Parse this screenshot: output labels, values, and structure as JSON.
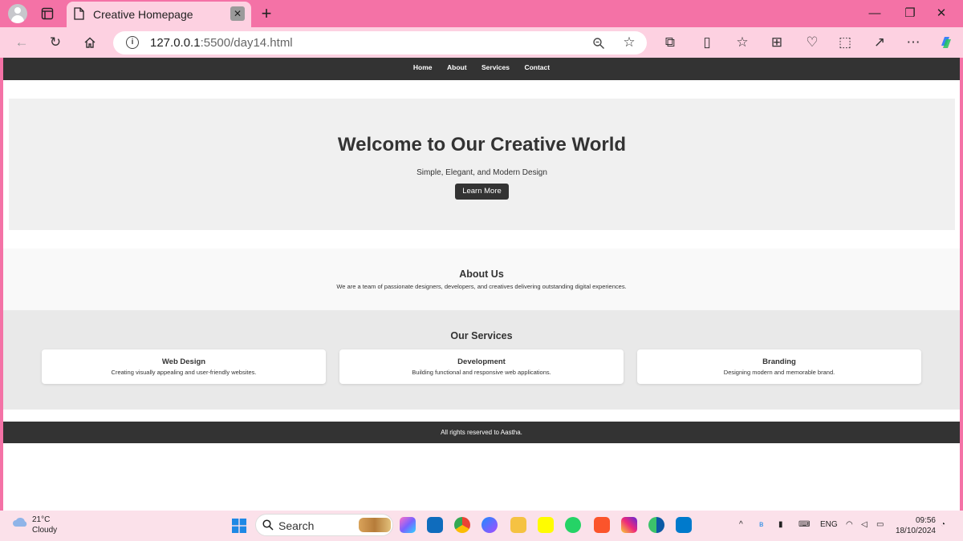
{
  "browser": {
    "tab_title": "Creative Homepage",
    "url_host": "127.0.0.1",
    "url_rest": ":5500/day14.html"
  },
  "page": {
    "nav": [
      "Home",
      "About",
      "Services",
      "Contact"
    ],
    "hero": {
      "title": "Welcome to Our Creative World",
      "subtitle": "Simple, Elegant, and Modern Design",
      "button": "Learn More"
    },
    "about": {
      "title": "About Us",
      "text": "We are a team of passionate designers, developers, and creatives delivering outstanding digital experiences."
    },
    "services": {
      "title": "Our Services",
      "cards": [
        {
          "title": "Web Design",
          "text": "Creating visually appealing and user-friendly websites."
        },
        {
          "title": "Development",
          "text": "Building functional and responsive web applications."
        },
        {
          "title": "Branding",
          "text": "Designing modern and memorable brand."
        }
      ]
    },
    "footer": "All rights reserved to Aastha."
  },
  "taskbar": {
    "weather_temp": "21°C",
    "weather_cond": "Cloudy",
    "search": "Search",
    "lang": "ENG",
    "time": "09:56",
    "date": "18/10/2024"
  },
  "colors": {
    "chrome_pink": "#f472a6",
    "toolbar_pink": "#fdd1e1",
    "dark": "#333333"
  }
}
